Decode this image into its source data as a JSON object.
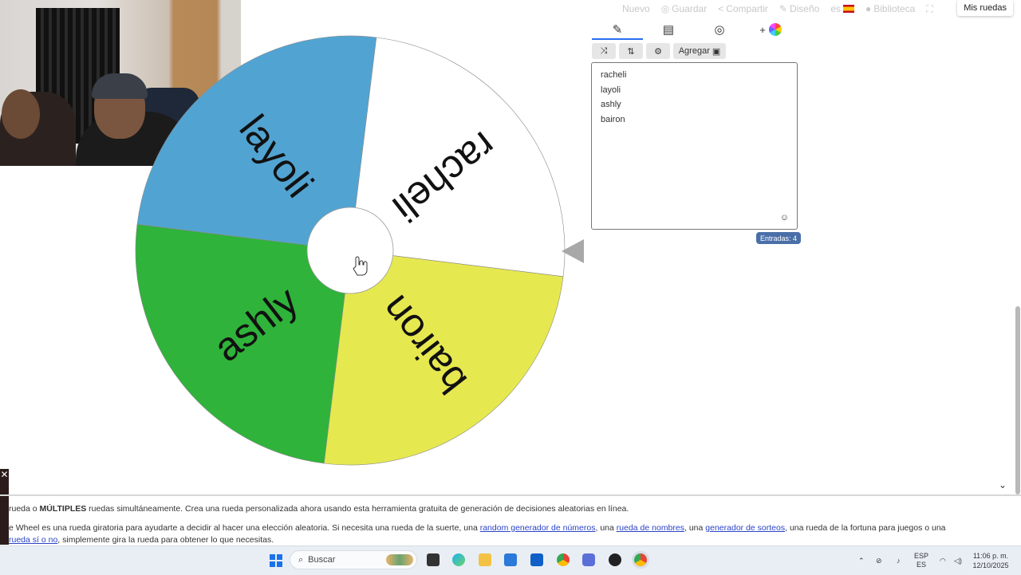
{
  "topnav": {
    "new": "Nuevo",
    "save": "Guardar",
    "share": "Compartir",
    "design": "Diseño",
    "lang": "es",
    "library": "Biblioteca",
    "my_wheels": "Mis ruedas"
  },
  "wheel": {
    "segments": [
      {
        "label": "racheli",
        "color": "#ffffff"
      },
      {
        "label": "bairon",
        "color": "#e6e84f"
      },
      {
        "label": "ashly",
        "color": "#2fb33a"
      },
      {
        "label": "layoli",
        "color": "#51a4d2"
      }
    ]
  },
  "panel": {
    "tabs": [
      "pencil-icon",
      "clipboard-icon",
      "eye-off-icon",
      "add-color-icon"
    ],
    "add_label": "Agregar",
    "entries": [
      "racheli",
      "layoli",
      "ashly",
      "bairon"
    ],
    "count_label": "Entradas: 4"
  },
  "bottom": {
    "line1_pre": "rueda o ",
    "line1_bold": "MÚLTIPLES",
    "line1_post": " ruedas simultáneamente. Crea una rueda personalizada ahora usando esta herramienta gratuita de generación de decisiones aleatorias en línea.",
    "line2_pre": "e Wheel es una rueda giratoria para ayudarte a decidir al hacer una elección aleatoria. Si necesita una rueda de la suerte, una ",
    "link1": "random generador de números",
    "sep1": ", una ",
    "link2": "rueda de nombres",
    "sep2": ", una ",
    "link3": "generador de sorteos",
    "line2_post": ", una rueda de la fortuna para juegos o una",
    "link4": "rueda sí o no",
    "line3_post": ", simplemente gira la rueda para obtener lo que necesitas."
  },
  "taskbar": {
    "search_placeholder": "Buscar",
    "lang_top": "ESP",
    "lang_bottom": "ES",
    "time": "11:06 p. m.",
    "date": "12/10/2025"
  },
  "colors": {
    "accent": "#2a6df0",
    "badge": "#4a6fa8",
    "link": "#2a43c8"
  }
}
